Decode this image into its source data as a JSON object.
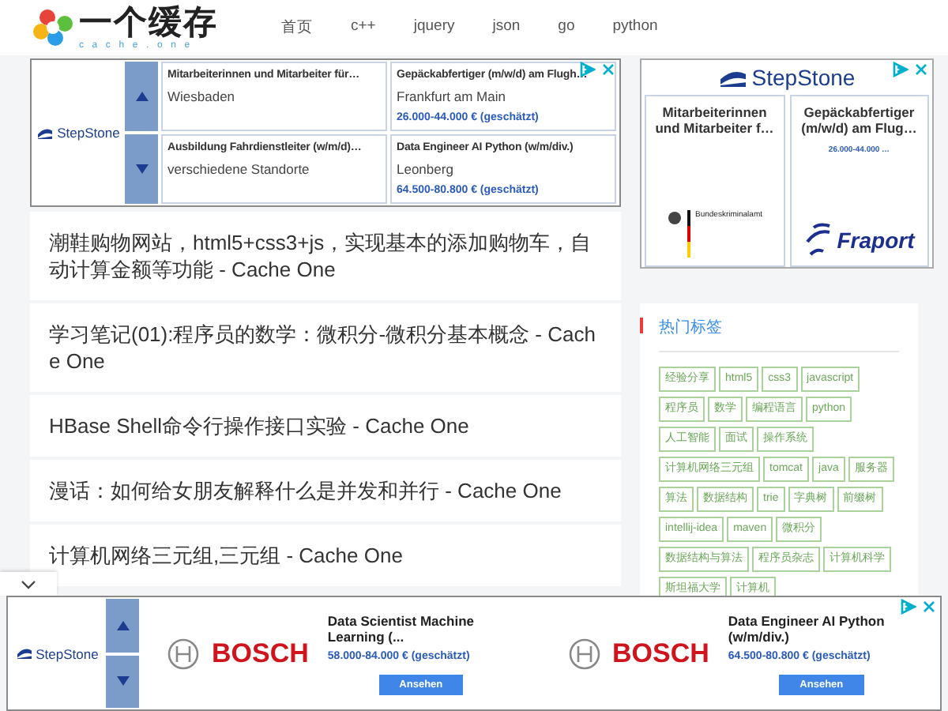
{
  "header": {
    "logo_title": "一个缓存",
    "logo_subtitle": "cache.one",
    "nav": [
      {
        "label": "首页",
        "selected": false
      },
      {
        "label": "c++",
        "selected": false
      },
      {
        "label": "jquery",
        "selected": false
      },
      {
        "label": "json",
        "selected": false
      },
      {
        "label": "go",
        "selected": false
      },
      {
        "label": "python",
        "selected": false
      }
    ]
  },
  "top_ad": {
    "brand": "StepStone",
    "jobs": [
      {
        "title": "Mitarbeiterinnen und Mitarbeiter für…",
        "location": "Wiesbaden"
      },
      {
        "title": "Gepäckabfertiger (m/w/d) am Flugh…",
        "location": "Frankfurt am Main",
        "salary": "26.000-44.000 € (geschätzt)"
      },
      {
        "title": "Ausbildung Fahrdienstleiter (w/m/d)…",
        "location": "verschiedene Standorte"
      },
      {
        "title": "Data Engineer AI Python (w/m/div.)",
        "location": "Leonberg",
        "salary": "64.500-80.800 € (geschätzt)"
      }
    ]
  },
  "articles": [
    {
      "title": "潮鞋购物网站，html5+css3+js，实现基本的添加购物车，自动计算金额等功能 - Cache One"
    },
    {
      "title": "学习笔记(01):程序员的数学：微积分-微积分基本概念 - Cache One"
    },
    {
      "title": "HBase Shell命令行操作接口实验 - Cache One"
    },
    {
      "title": "漫话：如何给女朋友解释什么是并发和并行 - Cache One"
    },
    {
      "title": "计算机网络三元组,三元组 - Cache One"
    }
  ],
  "side_ad": {
    "brand": "StepStone",
    "cards": [
      {
        "title": "Mitarbeiterinnen und Mitarbeiter f…",
        "logo": "Bundeskriminalamt",
        "kind": "eagle"
      },
      {
        "title": "Gepäckabfertiger (m/w/d) am Flug…",
        "salary": "26.000-44.000 …",
        "logo": "Fraport",
        "kind": "plane"
      }
    ]
  },
  "hot_tags": {
    "title": "热门标签",
    "tags": [
      "经验分享",
      "html5",
      "css3",
      "javascript",
      "程序员",
      "数学",
      "编程语言",
      "python",
      "人工智能",
      "面试",
      "操作系统",
      "计算机网络三元组",
      "tomcat",
      "java",
      "服务器",
      "算法",
      "数据结构",
      "trie",
      "字典树",
      "前缀树",
      "intellij-idea",
      "maven",
      "微积分",
      "数据结构与算法",
      "程序员杂志",
      "计算机科学",
      "斯坦福大学",
      "计算机"
    ]
  },
  "bottom_ad": {
    "brand": "StepStone",
    "jobs": [
      {
        "logo": "BOSCH",
        "title": "Data Scientist Machine Learning (...",
        "salary": "58.000-84.000 € (geschätzt)",
        "button": "Ansehen"
      },
      {
        "logo": "BOSCH",
        "title": "Data Engineer AI Python (w/m/div.)",
        "salary": "64.500-80.800 € (geschätzt)",
        "button": "Ansehen"
      }
    ]
  }
}
